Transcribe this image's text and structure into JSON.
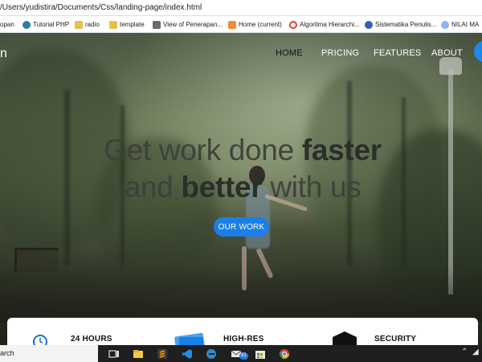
{
  "browser": {
    "url": "/Users/yudistira/Documents/Css/landing-page/index.html",
    "bookmarks": [
      {
        "label": "opan",
        "icon": "none"
      },
      {
        "label": "Tutorial PHP",
        "icon": "globe-icon"
      },
      {
        "label": "radio",
        "icon": "folder-icon"
      },
      {
        "label": "template",
        "icon": "folder-icon"
      },
      {
        "label": "View of Penerapan...",
        "icon": "document-icon"
      },
      {
        "label": "Home (current)",
        "icon": "home-icon"
      },
      {
        "label": "Algoritma Hierarchi...",
        "icon": "google-icon"
      },
      {
        "label": "Sistematika Penulis...",
        "icon": "wp-icon"
      },
      {
        "label": "NILAI MA",
        "icon": "cloud-icon"
      }
    ]
  },
  "page": {
    "logo": "n",
    "nav": [
      "HOME",
      "PRICING",
      "FEATURES",
      "ABOUT"
    ],
    "hero_line1_pre": "Get work done ",
    "hero_line1_bold": "faster",
    "hero_line2_pre": "and ",
    "hero_line2_bold": "better",
    "hero_line2_post": " with us",
    "cta": "OUR WORK",
    "features": [
      "24 HOURS",
      "HIGH-RES",
      "SECURITY"
    ]
  },
  "taskbar": {
    "search_text": "arch",
    "mail_badge": "81",
    "apps": [
      "task-view-icon",
      "file-explorer-icon",
      "sublime-icon",
      "vscode-icon",
      "edge-icon",
      "mail-icon",
      "store-icon",
      "chrome-icon"
    ]
  },
  "colors": {
    "accent": "#1a7fe6",
    "taskbar": "#1f1f1f"
  }
}
